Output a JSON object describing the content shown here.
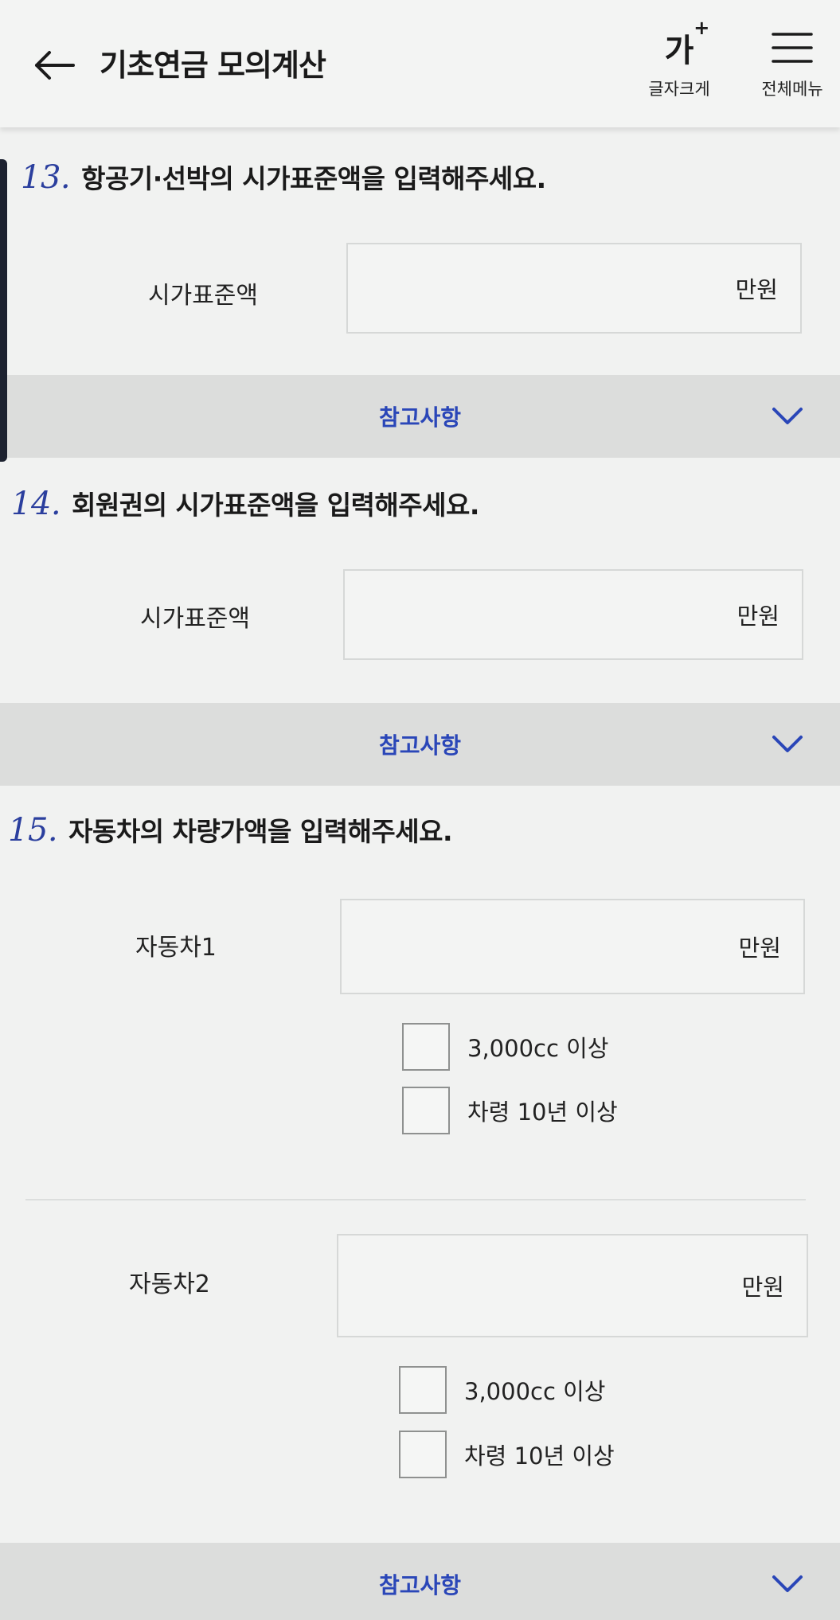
{
  "header": {
    "title": "기초연금 모의계산",
    "back_icon": "arrow-left-icon",
    "font_size": {
      "glyph": "가",
      "sup": "+",
      "label": "글자크게"
    },
    "menu": {
      "label": "전체메뉴",
      "icon": "hamburger-icon"
    }
  },
  "questions": [
    {
      "number": "13.",
      "text": "항공기·선박의 시가표준액을 입력해주세요.",
      "field_label": "시가표준액",
      "unit": "만원",
      "reference": "참고사항"
    },
    {
      "number": "14.",
      "text": "회원권의 시가표준액을 입력해주세요.",
      "field_label": "시가표준액",
      "unit": "만원",
      "reference": "참고사항"
    },
    {
      "number": "15.",
      "text": "자동차의 차량가액을 입력해주세요.",
      "reference": "참고사항",
      "cars": [
        {
          "label": "자동차1",
          "unit": "만원",
          "options": [
            "3,000cc 이상",
            "차령 10년 이상"
          ]
        },
        {
          "label": "자동차2",
          "unit": "만원",
          "options": [
            "3,000cc 이상",
            "차령 10년 이상"
          ]
        }
      ]
    }
  ],
  "colors": {
    "accent_blue": "#2a46b8",
    "number_blue": "#2b3f9e",
    "ref_bar": "#dcdddc",
    "background": "#f1f2f1"
  }
}
